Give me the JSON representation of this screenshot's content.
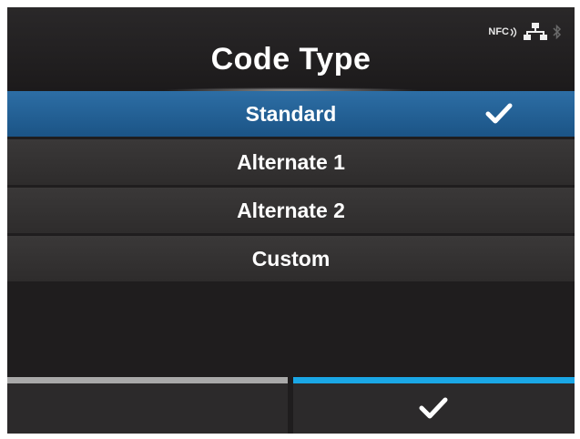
{
  "header": {
    "title": "Code Type",
    "status": {
      "nfc_label": "NFC",
      "icons": [
        "nfc-icon",
        "network-icon",
        "bluetooth-icon"
      ]
    }
  },
  "list": {
    "items": [
      {
        "label": "Standard",
        "selected": true
      },
      {
        "label": "Alternate 1",
        "selected": false
      },
      {
        "label": "Alternate 2",
        "selected": false
      },
      {
        "label": "Custom",
        "selected": false
      }
    ]
  },
  "softkeys": {
    "left": {
      "icon": "none",
      "bar_color": "#a9a9a9"
    },
    "right": {
      "icon": "checkmark-icon",
      "bar_color": "#1aa7e6"
    }
  },
  "colors": {
    "selected_row": "#1f5f97",
    "row": "#333131",
    "background": "#1f1d1e",
    "accent": "#1aa7e6"
  }
}
